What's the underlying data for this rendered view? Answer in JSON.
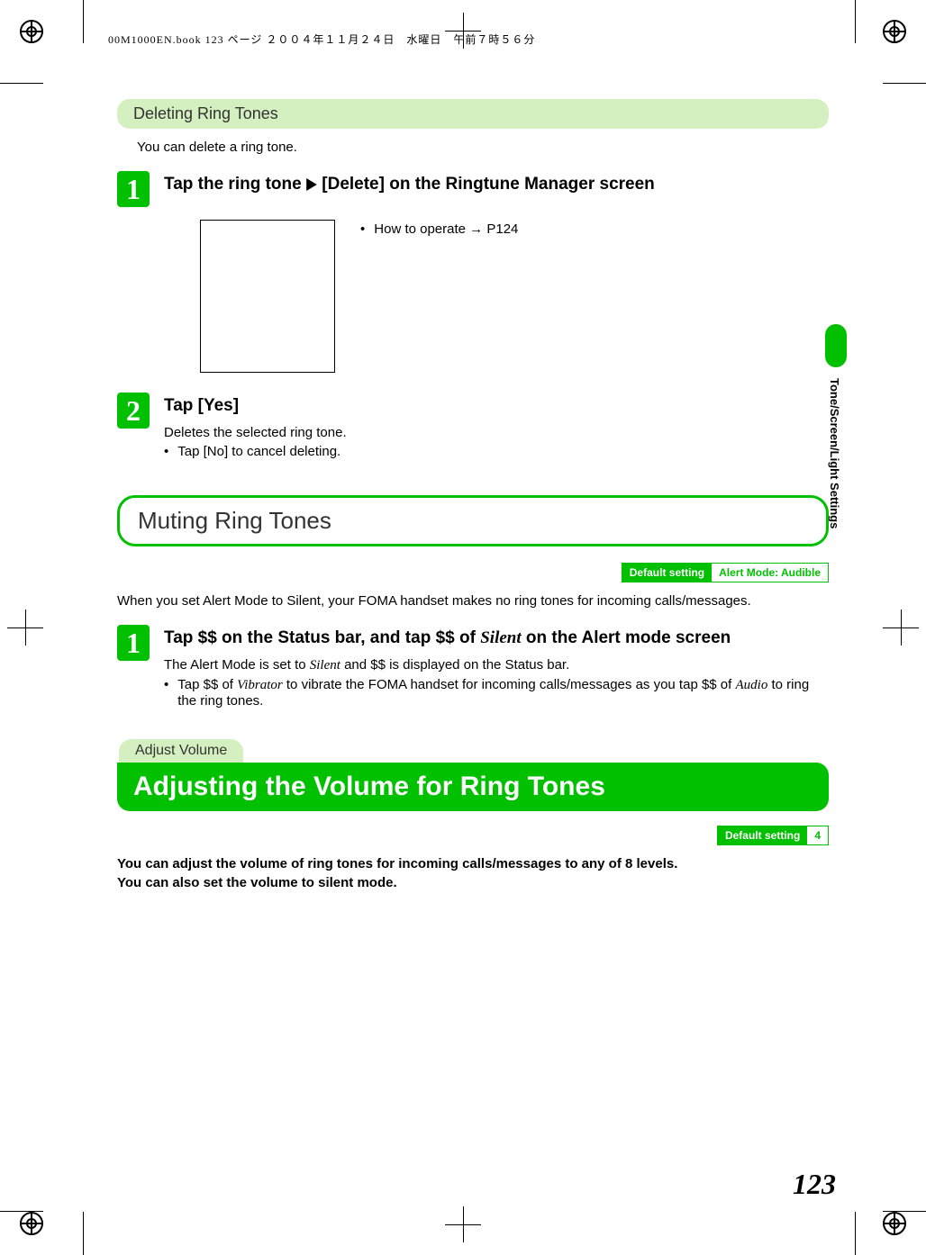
{
  "header_line": "00M1000EN.book  123 ページ  ２００４年１１月２４日　水曜日　午前７時５６分",
  "section1": {
    "title": "Deleting Ring Tones",
    "intro": "You can delete a ring tone.",
    "step1": {
      "num": "1",
      "title_before": "Tap the ring tone ",
      "title_after": " [Delete] on the Ringtune Manager screen",
      "note_prefix": "How to operate ",
      "note_arrow": "→",
      "note_ref": " P124"
    },
    "step2": {
      "num": "2",
      "title": "Tap [Yes]",
      "line1": "Deletes the selected ring tone.",
      "bullet1": "Tap [No] to cancel deleting."
    }
  },
  "section2": {
    "title": "Muting Ring Tones",
    "default_label": "Default setting",
    "default_value": "Alert Mode: Audible",
    "intro": "When you set Alert Mode to Silent, your FOMA handset makes no ring tones for incoming calls/messages.",
    "step1": {
      "num": "1",
      "t1": "Tap $$ on the Status bar, and tap $$ of ",
      "t_silent": "Silent",
      "t2": " on the Alert mode screen",
      "line1a": "The Alert Mode is set to ",
      "line1_silent": "Silent",
      "line1b": " and $$ is displayed on the Status bar.",
      "b1a": "Tap $$ of ",
      "b1_vib": "Vibrator",
      "b1b": " to vibrate the FOMA handset for incoming calls/messages as you tap $$ of ",
      "b1_audio": "Audio",
      "b1c": " to ring the ring tones."
    }
  },
  "section3": {
    "sub": "Adjust Volume",
    "main": "Adjusting the Volume for Ring Tones",
    "default_label": "Default setting",
    "default_value": "4",
    "bold_line1": "You can adjust the volume of ring tones for incoming calls/messages to any of 8 levels.",
    "bold_line2": "You can also set the volume to silent mode."
  },
  "side_label": "Tone/Screen/Light Settings",
  "page_number": "123"
}
